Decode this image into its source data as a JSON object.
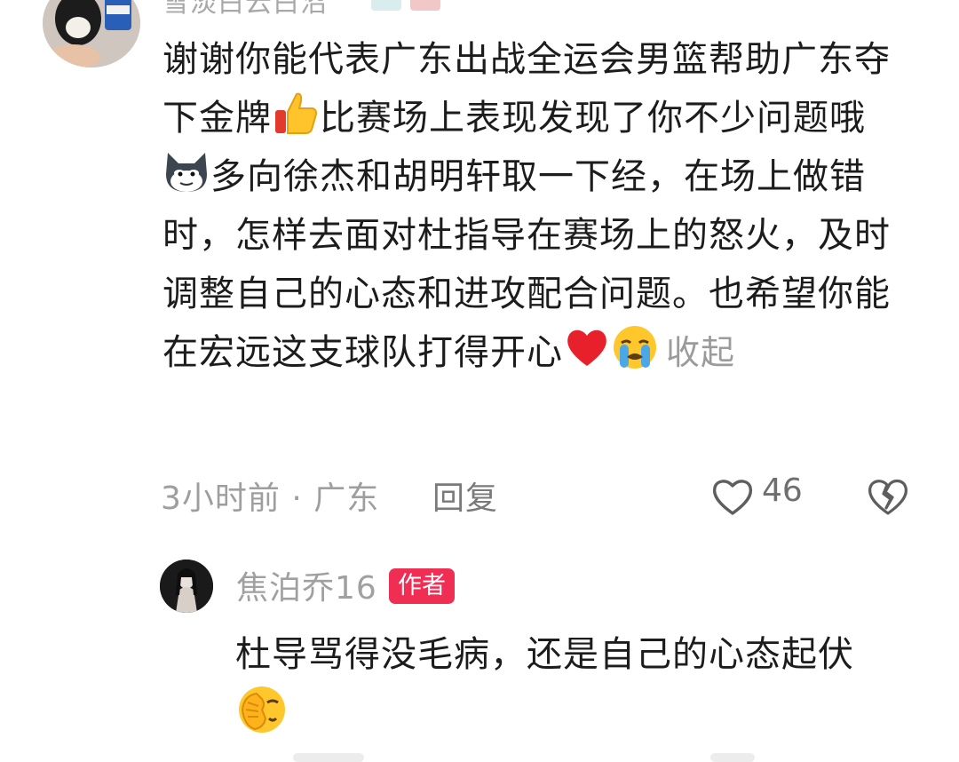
{
  "top_comment": {
    "username": "雪淡白云白沼",
    "text_part1": "谢谢你能代表广东出战全运会男篮帮助广东夺下金牌",
    "emoji1": "thumbs-up-emoji",
    "text_part2": "比赛场上表现发现了你不少问题哦",
    "emoji2": "smirk-cat-emoji",
    "text_part3": "多向徐杰和胡明轩取一下经，在场上做错时，怎样去面对杜指导在赛场上的怒火，及时调整自己的心态和进攻配合问题。也希望你能在宏远这支球队打得开心",
    "emoji3": "red-heart-emoji",
    "emoji4": "loudly-crying-emoji",
    "collapse_label": "收起",
    "meta": "3小时前 · 广东",
    "reply_label": "回复",
    "like_count": "46"
  },
  "reply": {
    "username": "焦泊乔16",
    "badge": "作者",
    "text": "杜导骂得没毛病，还是自己的心态起伏",
    "emoji": "face-palm-emoji"
  },
  "colors": {
    "badge_red": "#f02e54",
    "secondary_text": "#9e9e9e",
    "body_text": "#1c1c1c"
  }
}
